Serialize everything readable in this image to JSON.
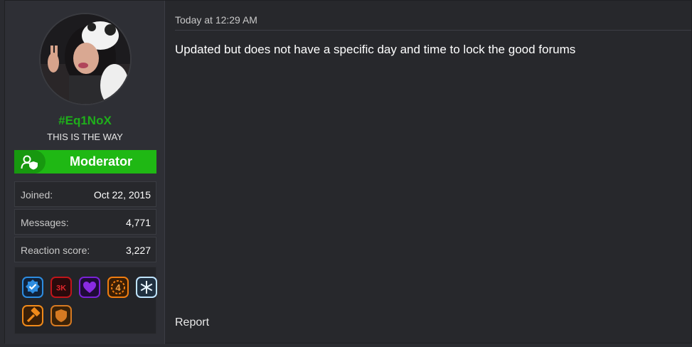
{
  "user": {
    "username": "#Eq1NoX",
    "user_title": "THIS IS THE WAY",
    "role": "Moderator",
    "avatar_icon": "user-avatar-photo",
    "username_color": "#1fae1b",
    "role_color": "#1fb814"
  },
  "stats": [
    {
      "label": "Joined:",
      "value": "Oct 22, 2015"
    },
    {
      "label": "Messages:",
      "value": "4,771"
    },
    {
      "label": "Reaction score:",
      "value": "3,227"
    }
  ],
  "trophies": [
    {
      "icon": "verified-check-badge-icon",
      "text": "",
      "color": "#2d8ce0"
    },
    {
      "icon": "3k-badge-icon",
      "text": "3K",
      "color": "#c0151a"
    },
    {
      "icon": "heart-badge-icon",
      "text": "",
      "color": "#7a22d6"
    },
    {
      "icon": "number-4-badge-icon",
      "text": "4",
      "color": "#f07d10"
    },
    {
      "icon": "snowflake-badge-icon",
      "text": "",
      "color": "#bfe4ff"
    },
    {
      "icon": "hammer-badge-icon",
      "text": "",
      "color": "#f08a1a"
    },
    {
      "icon": "shield-badge-icon",
      "text": "",
      "color": "#d67a22"
    }
  ],
  "post": {
    "timestamp": "Today at 12:29 AM",
    "message": "Updated but does not have a specific day and time to lock the good forums",
    "report_label": "Report"
  }
}
